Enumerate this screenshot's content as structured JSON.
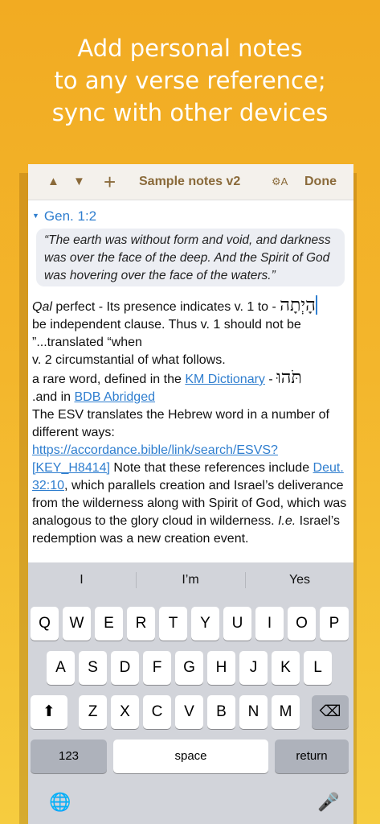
{
  "headline": {
    "line1": "Add personal notes",
    "line2": "to any verse reference;",
    "line3": "sync with other devices"
  },
  "toolbar": {
    "up_glyph": "▲",
    "down_glyph": "▼",
    "add_glyph": "+",
    "title": "Sample notes v2",
    "font_settings_glyph": "⚙A",
    "done_label": "Done"
  },
  "reference": {
    "toggle_glyph": "▼",
    "label": "Gen. 1:2"
  },
  "verse_text": "“The earth was without form and void, and darkness was over the face of the deep. And the Spirit of God was hovering over the face of the waters.”",
  "note": {
    "line1_italic": "Qal",
    "line1_text": " perfect - Its presence indicates v. 1 to - ",
    "line1_hebrew": "הָיְתָה",
    "line2": "be independent clause.  Thus v. 1 should not be ”...translated “when",
    "line3": "v. 2 circumstantial of what follows.",
    "line4_prefix": "a rare word, defined in the ",
    "line4_link": "KM Dictionary",
    "line4_suffix": " - ",
    "line4_hebrew": "תֹּהוּ",
    "line5_prefix": ".and in ",
    "line5_link": "BDB Abridged",
    "para_prefix": "The ESV translates the Hebrew word in a number of different ways: ",
    "para_link1": "https://accordance.bible/link/search/ESVS?[KEY_H8414]",
    "para_mid": " Note that these references include ",
    "para_link2": "Deut. 32:10",
    "para_mid2": ", which parallels creation and Israel’s deliverance from the wilderness along with Spirit of God, which was analogous to the glory cloud in wilderness. ",
    "para_italic": "I.e.",
    "para_end": " Israel’s redemption was a new creation event."
  },
  "keyboard": {
    "suggestions": [
      "I",
      "I’m",
      "Yes"
    ],
    "row1": [
      "Q",
      "W",
      "E",
      "R",
      "T",
      "Y",
      "U",
      "I",
      "O",
      "P"
    ],
    "row2": [
      "A",
      "S",
      "D",
      "F",
      "G",
      "H",
      "J",
      "K",
      "L"
    ],
    "row3": [
      "Z",
      "X",
      "C",
      "V",
      "B",
      "N",
      "M"
    ],
    "shift_glyph": "⬆",
    "delete_glyph": "⌫",
    "numbers_label": "123",
    "space_label": "space",
    "return_label": "return",
    "globe_glyph": "🌐",
    "mic_glyph": "🎤"
  }
}
